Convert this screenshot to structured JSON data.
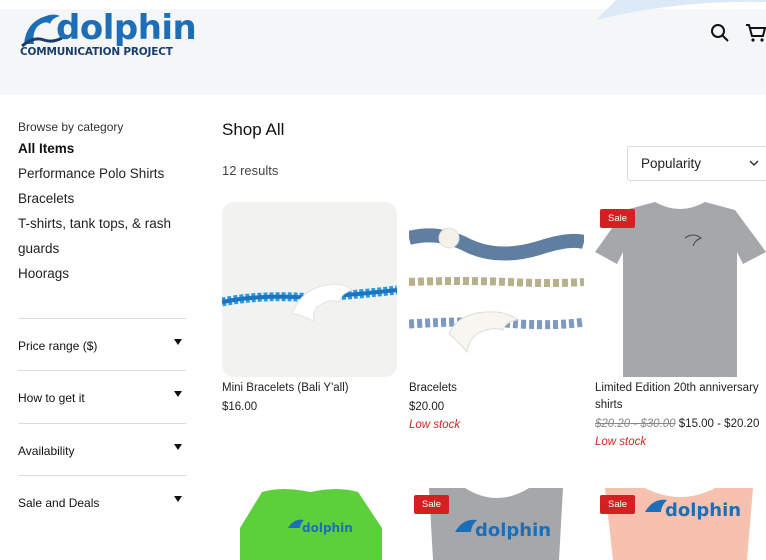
{
  "header": {
    "logo": {
      "word": "dolphin",
      "sub": "COMMUNICATION PROJECT"
    },
    "icons": [
      "search-icon",
      "cart-icon"
    ]
  },
  "sidebar": {
    "browse_label": "Browse by category",
    "categories": [
      {
        "label": "All Items",
        "active": true
      },
      {
        "label": "Performance Polo Shirts"
      },
      {
        "label": "Bracelets"
      },
      {
        "label": "T-shirts, tank tops, & rash"
      },
      {
        "label": "guards"
      },
      {
        "label": "Hoorags"
      }
    ],
    "filters": [
      {
        "label": "Price range ($)"
      },
      {
        "label": "How to get it"
      },
      {
        "label": "Availability"
      },
      {
        "label": "Sale and Deals"
      }
    ]
  },
  "main": {
    "title": "Shop All",
    "results": "12 results",
    "sort": {
      "selected": "Popularity"
    },
    "products": [
      {
        "name": "Mini Bracelets (Bali Y'all)",
        "price": "$16.00",
        "low_stock": "",
        "sale": false
      },
      {
        "name": "Bracelets",
        "price": "$20.00",
        "low_stock": "Low stock",
        "sale": false
      },
      {
        "name": "Limited Edition 20th anniversary",
        "name2": "shirts",
        "old_price": "$20.20 - $30.00",
        "price": "$15.00 - $20.20",
        "low_stock": "Low stock",
        "sale": true,
        "badge": "Sale"
      },
      {
        "sale": false
      },
      {
        "sale": true,
        "badge": "Sale"
      },
      {
        "sale": true,
        "badge": "Sale"
      }
    ]
  },
  "colors": {
    "brand": "#1c6fb6",
    "sale": "#d42020",
    "low_stock": "#c62828"
  }
}
